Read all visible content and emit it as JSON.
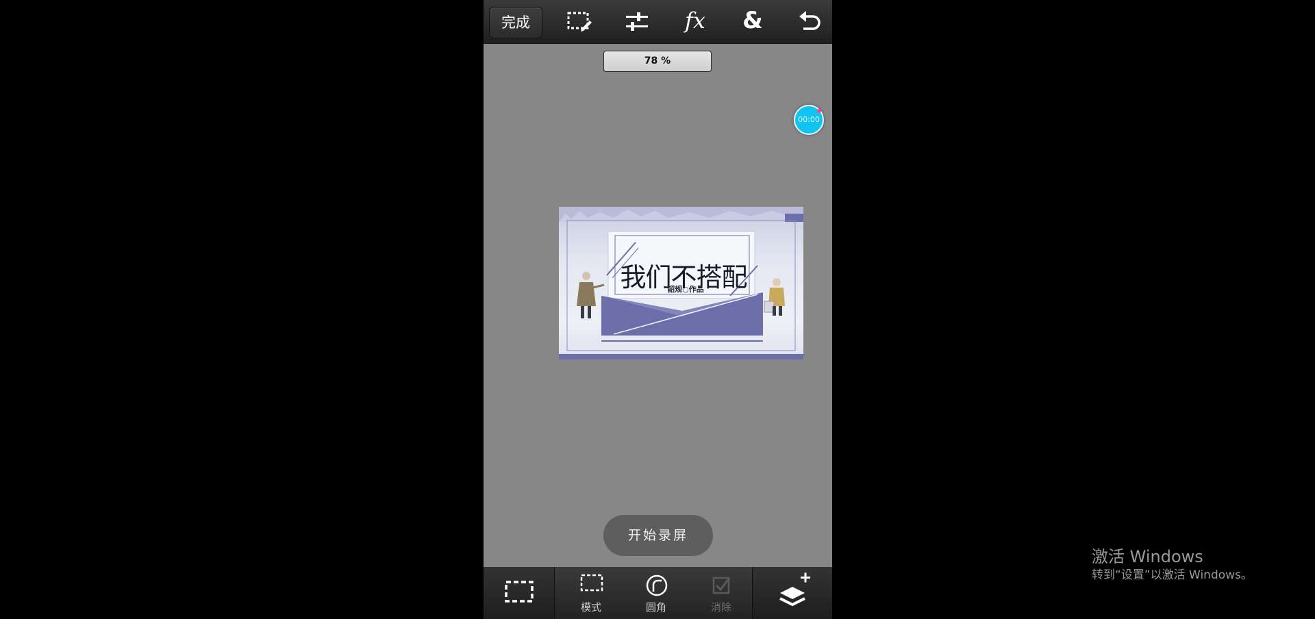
{
  "toolbar": {
    "done_label": "完成",
    "icons": [
      "selection-edit-icon",
      "adjust-sliders-icon",
      "fx-icon",
      "ampersand-icon",
      "undo-icon"
    ],
    "fx_label": "fx",
    "amp_label": "&"
  },
  "zoom": {
    "value": "78 %"
  },
  "timer": {
    "value": "00:00"
  },
  "artwork": {
    "title": "我们不搭配",
    "subtitle": "韶规○作品",
    "accent_color": "#6b6ea8"
  },
  "record_button": {
    "label": "开始录屏"
  },
  "bottom_tools": {
    "mode_label": "模式",
    "round_label": "圆角",
    "clear_label": "消除"
  },
  "watermark": {
    "title": "激活 Windows",
    "subtitle": "转到“设置”以激活 Windows。"
  }
}
